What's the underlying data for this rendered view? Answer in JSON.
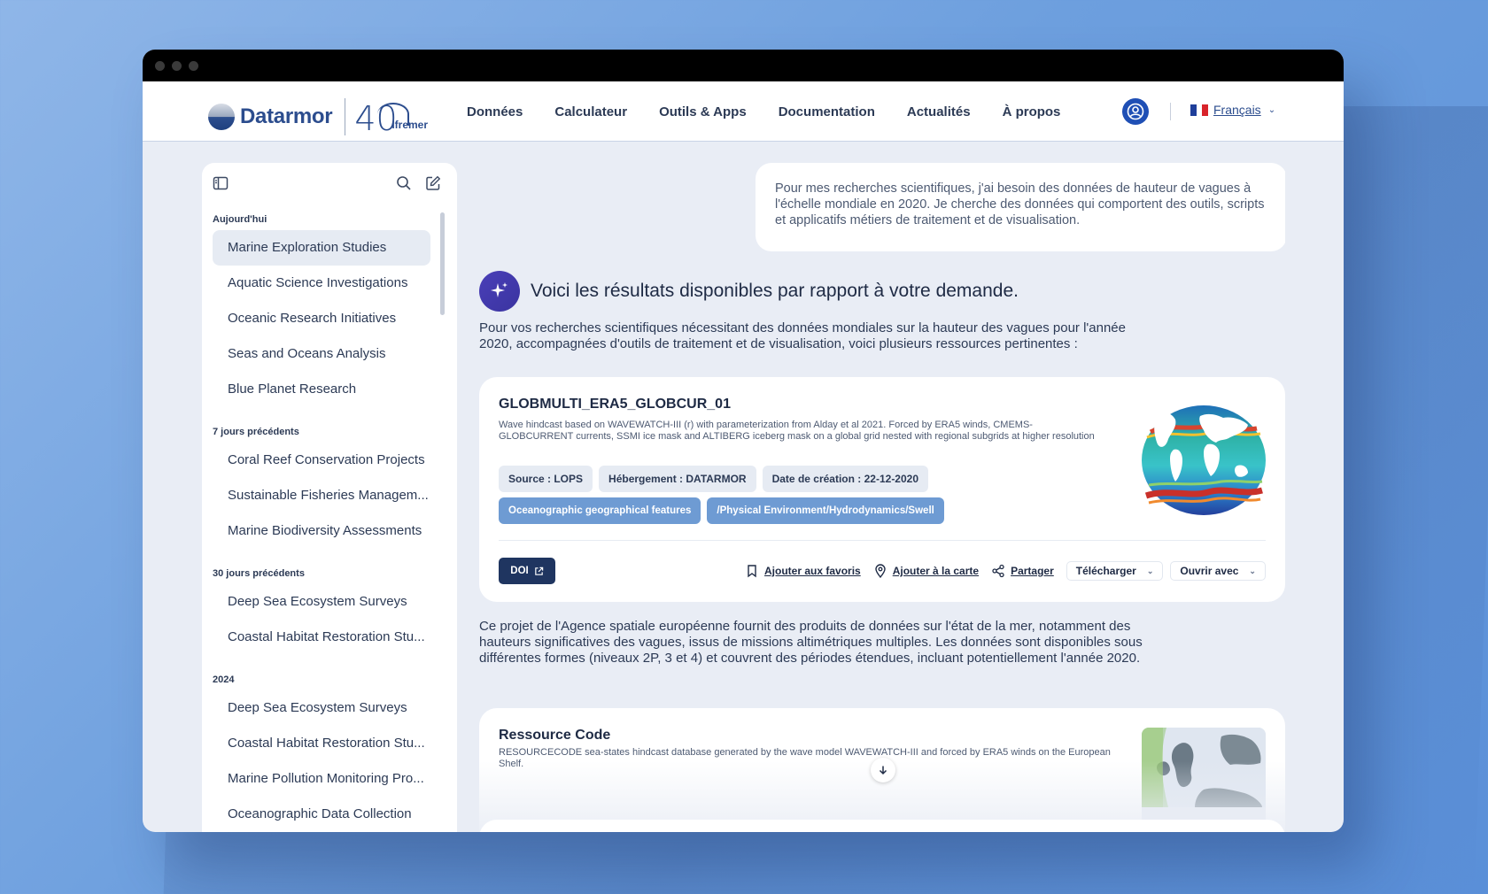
{
  "brand": {
    "name": "Datarmor",
    "partner_number": "40",
    "partner_name": "Ifremer"
  },
  "nav": {
    "items": [
      "Données",
      "Calculateur",
      "Outils & Apps",
      "Documentation",
      "Actualités",
      "À propos"
    ],
    "language": "Français"
  },
  "sidebar": {
    "groups": [
      {
        "title": "Aujourd'hui",
        "items": [
          "Marine Exploration Studies",
          "Aquatic Science Investigations",
          "Oceanic Research Initiatives",
          "Seas and Oceans Analysis",
          "Blue Planet Research"
        ]
      },
      {
        "title": "7 jours précédents",
        "items": [
          "Coral Reef Conservation Projects",
          "Sustainable Fisheries Managem...",
          "Marine Biodiversity Assessments"
        ]
      },
      {
        "title": "30 jours précédents",
        "items": [
          "Deep Sea Ecosystem Surveys",
          "Coastal Habitat Restoration Stu..."
        ]
      },
      {
        "title": "2024",
        "items": [
          "Deep Sea Ecosystem Surveys",
          "Coastal Habitat Restoration Stu...",
          "Marine Pollution Monitoring Pro...",
          "Oceanographic Data Collection"
        ]
      }
    ]
  },
  "query": "Pour mes recherches scientifiques, j'ai besoin des données de hauteur de vagues à l'échelle mondiale en 2020. Je cherche des données qui comportent des outils, scripts et applicatifs métiers de traitement et de visualisation.",
  "response": {
    "title": "Voici les résultats disponibles par rapport à votre demande.",
    "intro": "Pour vos recherches scientifiques nécessitant des données mondiales sur la hauteur des vagues pour l'année 2020, accompagnées d'outils de traitement et de visualisation, voici plusieurs ressources pertinentes :",
    "paragraph": "Ce projet de l'Agence spatiale européenne fournit des produits de données sur l'état de la mer, notamment des hauteurs significatives des vagues, issus de missions altimétriques multiples. Les données sont disponibles sous différentes formes (niveaux 2P, 3 et 4) et couvrent des périodes étendues, incluant potentiellement l'année 2020."
  },
  "card1": {
    "title": "GLOBMULTI_ERA5_GLOBCUR_01",
    "description": "Wave hindcast based on WAVEWATCH-III (r) with parameterization from Alday et al 2021. Forced by ERA5 winds, CMEMS-GLOBCURRENT currents, SSMI ice mask and ALTIBERG iceberg mask on a global grid nested with regional subgrids at higher resolution",
    "meta_tags": [
      "Source : LOPS",
      "Hébergement : DATARMOR",
      "Date de création : 22-12-2020"
    ],
    "keyword_tags": [
      "Oceanographic geographical features",
      "/Physical Environment/Hydrodynamics/Swell"
    ],
    "doi_label": "DOI",
    "actions": {
      "favorite": "Ajouter aux favoris",
      "map": "Ajouter à la carte",
      "share": "Partager",
      "download": "Télécharger",
      "open_with": "Ouvrir avec"
    }
  },
  "card2": {
    "title": "Ressource Code",
    "description": "RESOURCECODE sea-states hindcast database generated by the wave model WAVEWATCH-III and forced by ERA5 winds on the European Shelf."
  },
  "colors": {
    "primary": "#1f4fb5",
    "dark": "#1f3560",
    "tag_blue": "#6e9bd3",
    "accent_purple": "#4a3fb8"
  }
}
